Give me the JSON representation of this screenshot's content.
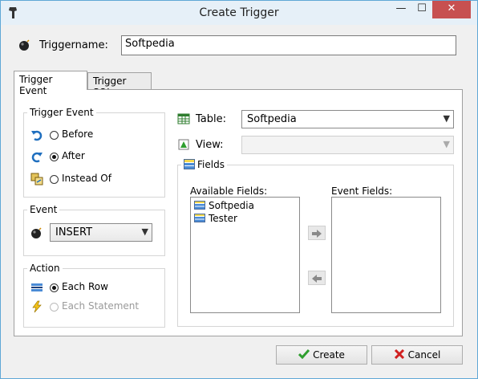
{
  "window": {
    "title": "Create Trigger",
    "min_glyph": "—",
    "max_glyph": "☐",
    "close_glyph": "✕"
  },
  "triggername": {
    "label": "Triggername:",
    "value": "Softpedia"
  },
  "tabs": [
    {
      "label": "Trigger Event",
      "active": true
    },
    {
      "label": "Trigger SQL",
      "active": false
    }
  ],
  "trigger_event": {
    "title": "Trigger Event",
    "options": [
      {
        "label": "Before",
        "checked": false
      },
      {
        "label": "After",
        "checked": true
      },
      {
        "label": "Instead Of",
        "checked": false
      }
    ]
  },
  "event": {
    "title": "Event",
    "value": "INSERT"
  },
  "action": {
    "title": "Action",
    "options": [
      {
        "label": "Each Row",
        "checked": true,
        "enabled": true
      },
      {
        "label": "Each Statement",
        "checked": false,
        "enabled": false
      }
    ]
  },
  "table": {
    "label": "Table:",
    "value": "Softpedia"
  },
  "view": {
    "label": "View:",
    "value": ""
  },
  "fields": {
    "title": "Fields",
    "available_label": "Available Fields:",
    "available": [
      "Softpedia",
      "Tester"
    ],
    "event_label": "Event Fields:",
    "event": []
  },
  "buttons": {
    "create": "Create",
    "cancel": "Cancel"
  },
  "colors": {
    "title_bar": "#e6f0f8",
    "close_button": "#c75050",
    "window_border": "#5fa7d6",
    "check_icon": "#2e9e2e",
    "cancel_icon": "#d02020"
  }
}
